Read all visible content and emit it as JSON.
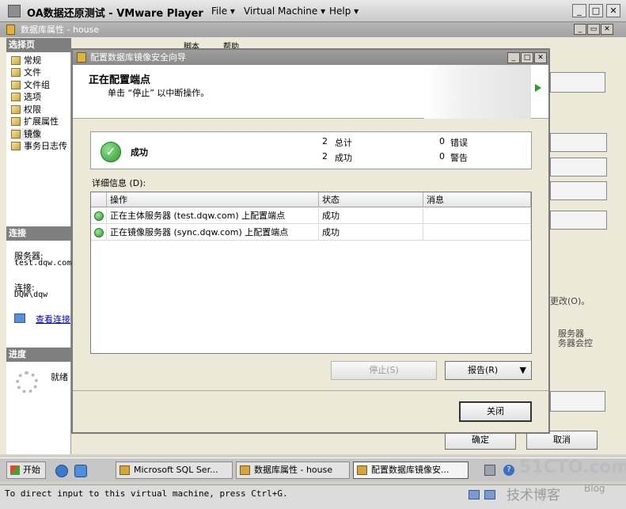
{
  "vmware": {
    "title": "OA数据还原测试 - VMware Player",
    "menu": [
      "File",
      "Virtual Machine",
      "Help"
    ]
  },
  "props": {
    "title": "数据库属性 - house",
    "left": {
      "section_select": "选择页",
      "items": [
        "常规",
        "文件",
        "文件组",
        "选项",
        "权限",
        "扩展属性",
        "镜像",
        "事务日志传"
      ],
      "section_connect": "连接",
      "server_label": "服务器:",
      "server_value": "test.dqw.com",
      "conn_label": "连接:",
      "conn_value": "DQW\\dqw",
      "view_link": "查看连接",
      "section_progress": "进度",
      "progress_status": "就绪"
    },
    "toolbar": {
      "script": "脚本",
      "help": "帮助"
    },
    "right_partial": {
      "text1": "更改(O)。",
      "text2": "服务器",
      "text3": "务器会控"
    },
    "ok": "确定",
    "cancel": "取消"
  },
  "dialog": {
    "title": "配置数据库镜像安全向导",
    "heading": "正在配置端点",
    "subheading": "单击 “停止” 以中断操作。",
    "summary": {
      "status": "成功",
      "total_count": "2",
      "total_label": "总计",
      "success_count": "2",
      "success_label": "成功",
      "error_count": "0",
      "error_label": "错误",
      "warning_count": "0",
      "warning_label": "警告"
    },
    "details_label": "详细信息 (D):",
    "columns": [
      "操作",
      "状态",
      "消息"
    ],
    "rows": [
      {
        "action": "正在主体服务器 (test.dqw.com) 上配置端点",
        "status": "成功",
        "message": ""
      },
      {
        "action": "正在镜像服务器 (sync.dqw.com) 上配置端点",
        "status": "成功",
        "message": ""
      }
    ],
    "stop_btn": "停止(S)",
    "report_btn": "报告(R)",
    "close_btn": "关闭"
  },
  "taskbar": {
    "start": "开始",
    "items": [
      "Microsoft SQL Ser...",
      "数据库属性 - house",
      "配置数据库镜像安..."
    ]
  },
  "statusbar": "To direct input to this virtual machine, press Ctrl+G.",
  "watermark": {
    "site": "51CTO.com",
    "sub": "技术博客",
    "blog": "Blog"
  }
}
